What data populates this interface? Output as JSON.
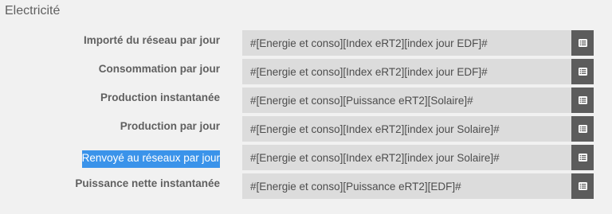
{
  "section": {
    "title": "Electricité"
  },
  "rows": [
    {
      "label": "Importé du réseau par jour",
      "value": "#[Energie et conso][Index eRT2][index jour EDF]#",
      "button_icon": "list-icon"
    },
    {
      "label": "Consommation par jour",
      "value": "#[Energie et conso][Index eRT2][index jour EDF]#",
      "button_icon": "list-icon"
    },
    {
      "label": "Production instantanée",
      "value": "#[Energie et conso][Puissance eRT2][Solaire]#",
      "button_icon": "list-icon"
    },
    {
      "label": "Production par jour",
      "value": "#[Energie et conso][Index eRT2][index jour Solaire]#",
      "button_icon": "list-icon"
    },
    {
      "label": "Renvoyé au réseaux par jour",
      "value": "#[Energie et conso][Index eRT2][index jour Solaire]#",
      "button_icon": "list-icon",
      "selected": true
    },
    {
      "label": "Puissance nette instantanée",
      "value": "#[Energie et conso][Puissance eRT2][EDF]#",
      "button_icon": "list-icon"
    }
  ],
  "colors": {
    "background": "#f1f1f1",
    "field_background": "#dcdcdc",
    "button_background": "#5c5c5c",
    "selection": "#3a93ea"
  }
}
